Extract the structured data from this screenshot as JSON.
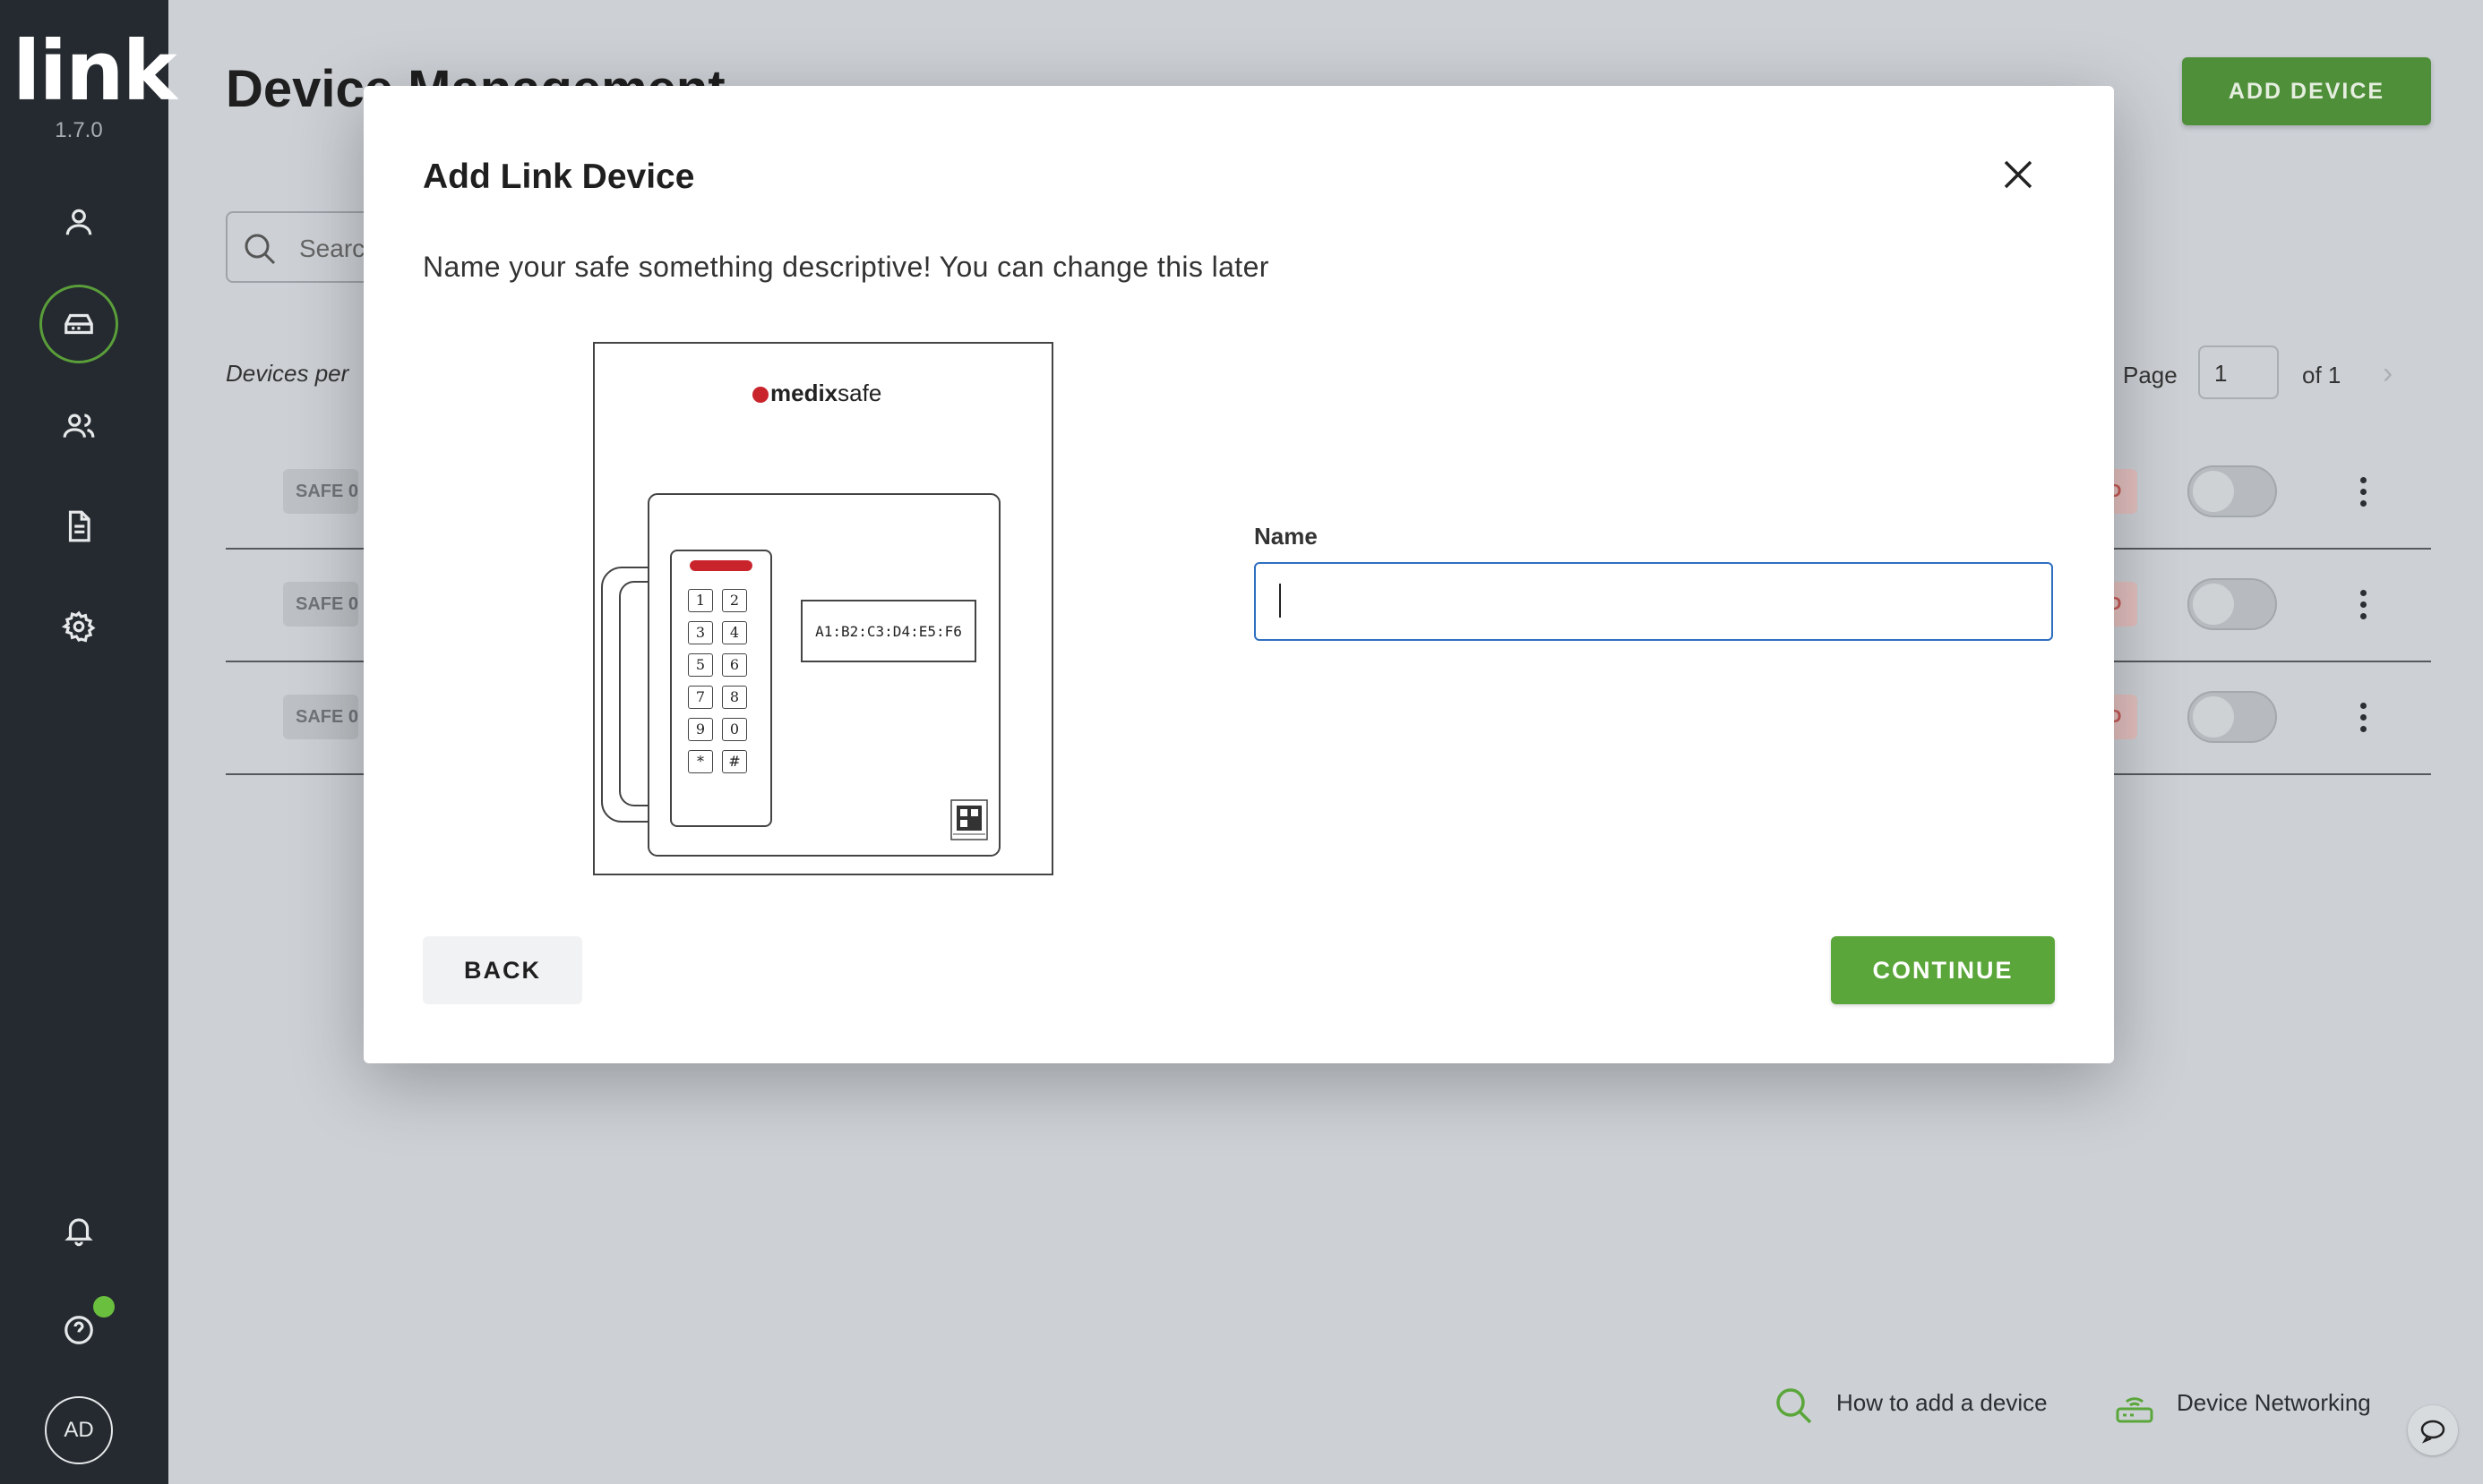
{
  "app": {
    "logo": "link",
    "version": "1.7.0"
  },
  "sidebar": {
    "items": [
      {
        "name": "user-icon"
      },
      {
        "name": "devices-icon",
        "active": true
      },
      {
        "name": "users-icon"
      },
      {
        "name": "document-icon"
      },
      {
        "name": "gear-icon"
      }
    ],
    "bottom": [
      "bell-icon",
      "help-icon",
      "avatar"
    ],
    "avatar_initials": "AD"
  },
  "page": {
    "title": "Device Management",
    "add_device_label": "ADD DEVICE",
    "search_placeholder": "Search",
    "devices_per_page_label": "Devices per",
    "pager": {
      "page_label": "Page",
      "page_value": "1",
      "of_label": "of 1"
    },
    "rows": [
      {
        "safe_label": "SAFE 0",
        "status": "D"
      },
      {
        "safe_label": "SAFE 0",
        "status": "D"
      },
      {
        "safe_label": "SAFE 0",
        "status": "D"
      }
    ]
  },
  "footer": {
    "how_to_label": "How to add a device",
    "networking_label": "Device Networking"
  },
  "modal": {
    "title": "Add Link Device",
    "subtitle": "Name your safe something descriptive! You can change this later",
    "illustration": {
      "brand_prefix": "medix",
      "brand_suffix": "safe",
      "mac_address": "A1:B2:C3:D4:E5:F6",
      "keys": [
        "1",
        "2",
        "3",
        "4",
        "5",
        "6",
        "7",
        "8",
        "9",
        "0",
        "*",
        "#"
      ]
    },
    "name_label": "Name",
    "name_value": "",
    "back_label": "BACK",
    "continue_label": "CONTINUE"
  },
  "colors": {
    "sidebar_bg": "#242a2f",
    "accent_green": "#5aa63a",
    "input_focus": "#2f6fbf",
    "brand_red": "#c9242c"
  }
}
